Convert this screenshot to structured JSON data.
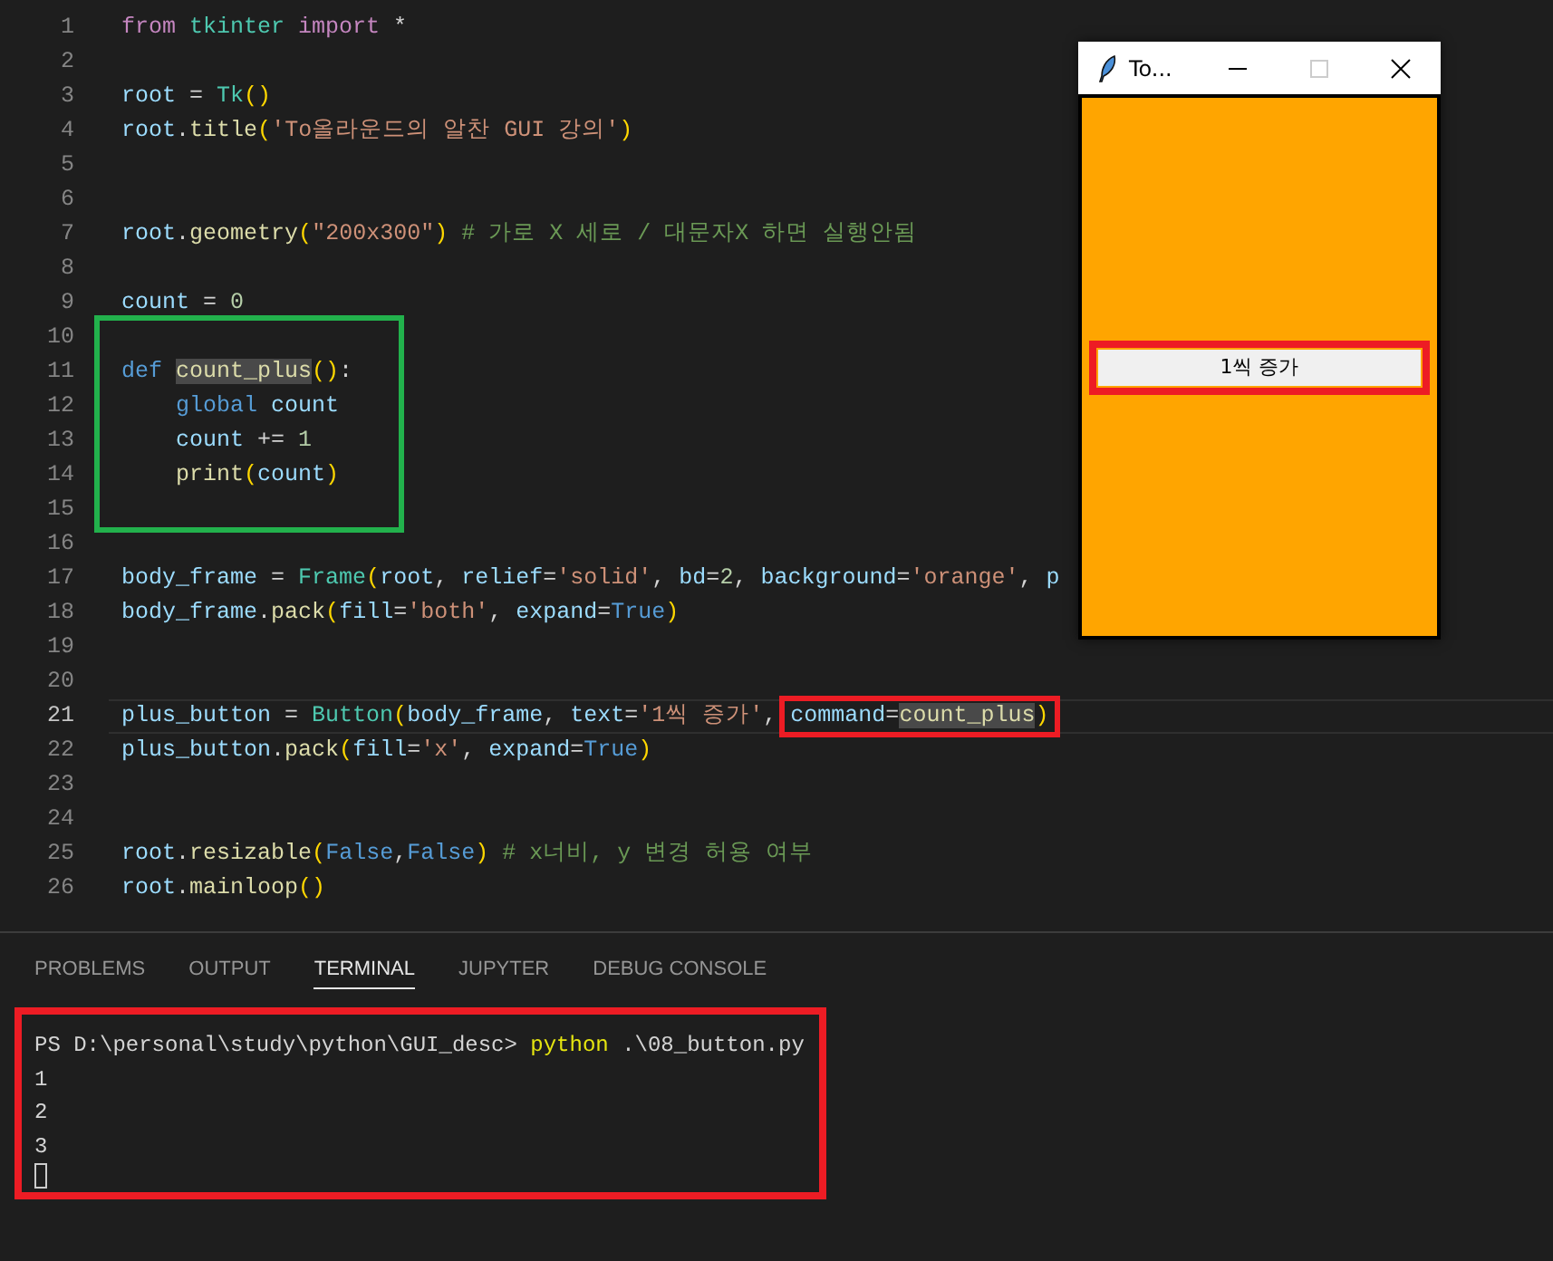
{
  "editor": {
    "lines": [
      {
        "number": "1",
        "current": false,
        "framed": false,
        "tokens": [
          {
            "text": "from",
            "kind": "kw"
          },
          {
            "text": " tkinter",
            "kind": "cls"
          },
          {
            "text": " import",
            "kind": "kw"
          },
          {
            "text": " *",
            "kind": "plain"
          }
        ]
      },
      {
        "number": "2",
        "current": false,
        "framed": false
      },
      {
        "number": "3",
        "current": false,
        "framed": false,
        "tokens": [
          {
            "text": "root",
            "kind": "var"
          },
          {
            "text": " = ",
            "kind": "plain"
          },
          {
            "text": "Tk",
            "kind": "cls"
          },
          {
            "text": "()",
            "kind": "paren"
          }
        ]
      },
      {
        "number": "4",
        "current": false,
        "framed": false,
        "tokens": [
          {
            "text": "root",
            "kind": "var"
          },
          {
            "text": ".",
            "kind": "plain"
          },
          {
            "text": "title",
            "kind": "fn"
          },
          {
            "text": "(",
            "kind": "paren"
          },
          {
            "text": "'To올라운드의 알찬 GUI 강의'",
            "kind": "str"
          },
          {
            "text": ")",
            "kind": "paren"
          }
        ]
      },
      {
        "number": "5",
        "current": false,
        "framed": false
      },
      {
        "number": "6",
        "current": false,
        "framed": false
      },
      {
        "number": "7",
        "current": false,
        "framed": false,
        "tokens": [
          {
            "text": "root",
            "kind": "var"
          },
          {
            "text": ".",
            "kind": "plain"
          },
          {
            "text": "geometry",
            "kind": "fn"
          },
          {
            "text": "(",
            "kind": "paren"
          },
          {
            "text": "\"200x300\"",
            "kind": "str"
          },
          {
            "text": ")",
            "kind": "paren"
          },
          {
            "text": " # 가로 X 세로 / 대문자X 하면 실행안됨",
            "kind": "cmt"
          }
        ]
      },
      {
        "number": "8",
        "current": false,
        "framed": false
      },
      {
        "number": "9",
        "current": false,
        "framed": false,
        "tokens": [
          {
            "text": "count",
            "kind": "var"
          },
          {
            "text": " = ",
            "kind": "plain"
          },
          {
            "text": "0",
            "kind": "num"
          }
        ]
      },
      {
        "number": "10",
        "current": false,
        "framed": true
      },
      {
        "number": "11",
        "current": false,
        "framed": true,
        "tokens": [
          {
            "text": "def ",
            "kind": "def"
          },
          {
            "text": "count_plus",
            "kind": "hl"
          },
          {
            "text": "()",
            "kind": "paren"
          },
          {
            "text": ":",
            "kind": "plain"
          }
        ]
      },
      {
        "number": "12",
        "current": false,
        "framed": true,
        "tokens": [
          {
            "text": "    global",
            "kind": "def"
          },
          {
            "text": " count",
            "kind": "var"
          }
        ]
      },
      {
        "number": "13",
        "current": false,
        "framed": true,
        "tokens": [
          {
            "text": "    count",
            "kind": "var"
          },
          {
            "text": " += ",
            "kind": "plain"
          },
          {
            "text": "1",
            "kind": "num"
          }
        ]
      },
      {
        "number": "14",
        "current": false,
        "framed": true,
        "tokens": [
          {
            "text": "    print",
            "kind": "fn"
          },
          {
            "text": "(",
            "kind": "paren"
          },
          {
            "text": "count",
            "kind": "var"
          },
          {
            "text": ")",
            "kind": "paren"
          }
        ]
      },
      {
        "number": "15",
        "current": false,
        "framed": true
      },
      {
        "number": "16",
        "current": false,
        "framed": false
      },
      {
        "number": "17",
        "current": false,
        "framed": false,
        "tokens": [
          {
            "text": "body_frame",
            "kind": "var"
          },
          {
            "text": " = ",
            "kind": "plain"
          },
          {
            "text": "Frame",
            "kind": "cls"
          },
          {
            "text": "(",
            "kind": "paren"
          },
          {
            "text": "root",
            "kind": "var"
          },
          {
            "text": ", ",
            "kind": "plain"
          },
          {
            "text": "relief",
            "kind": "var"
          },
          {
            "text": "=",
            "kind": "plain"
          },
          {
            "text": "'solid'",
            "kind": "str"
          },
          {
            "text": ", ",
            "kind": "plain"
          },
          {
            "text": "bd",
            "kind": "var"
          },
          {
            "text": "=",
            "kind": "plain"
          },
          {
            "text": "2",
            "kind": "num"
          },
          {
            "text": ", ",
            "kind": "plain"
          },
          {
            "text": "background",
            "kind": "var"
          },
          {
            "text": "=",
            "kind": "plain"
          },
          {
            "text": "'orange'",
            "kind": "str"
          },
          {
            "text": ", ",
            "kind": "plain"
          },
          {
            "text": "p",
            "kind": "var"
          }
        ]
      },
      {
        "number": "18",
        "current": false,
        "framed": false,
        "tokens": [
          {
            "text": "body_frame",
            "kind": "var"
          },
          {
            "text": ".",
            "kind": "plain"
          },
          {
            "text": "pack",
            "kind": "fn"
          },
          {
            "text": "(",
            "kind": "paren"
          },
          {
            "text": "fill",
            "kind": "var"
          },
          {
            "text": "=",
            "kind": "plain"
          },
          {
            "text": "'both'",
            "kind": "str"
          },
          {
            "text": ", ",
            "kind": "plain"
          },
          {
            "text": "expand",
            "kind": "var"
          },
          {
            "text": "=",
            "kind": "plain"
          },
          {
            "text": "True",
            "kind": "def"
          },
          {
            "text": ")",
            "kind": "paren"
          }
        ]
      },
      {
        "number": "19",
        "current": false,
        "framed": false
      },
      {
        "number": "20",
        "current": false,
        "framed": false
      },
      {
        "number": "21",
        "current": true,
        "framed": false,
        "tokens": [
          {
            "text": "plus_button",
            "kind": "var"
          },
          {
            "text": " = ",
            "kind": "plain"
          },
          {
            "text": "Button",
            "kind": "cls"
          },
          {
            "text": "(",
            "kind": "paren"
          },
          {
            "text": "body_frame",
            "kind": "var"
          },
          {
            "text": ", ",
            "kind": "plain"
          },
          {
            "text": "text",
            "kind": "var"
          },
          {
            "text": "=",
            "kind": "plain"
          },
          {
            "text": "'1씩 증가'",
            "kind": "str"
          },
          {
            "text": ", ",
            "kind": "plain"
          },
          {
            "text": "command",
            "kind": "var",
            "framed": true
          },
          {
            "text": "=",
            "kind": "plain",
            "framed": true
          },
          {
            "text": "count_plus",
            "kind": "hl",
            "framed": true
          },
          {
            "text": ")",
            "kind": "paren",
            "framed": true
          }
        ]
      },
      {
        "number": "22",
        "current": false,
        "framed": false,
        "tokens": [
          {
            "text": "plus_button",
            "kind": "var"
          },
          {
            "text": ".",
            "kind": "plain"
          },
          {
            "text": "pack",
            "kind": "fn"
          },
          {
            "text": "(",
            "kind": "paren"
          },
          {
            "text": "fill",
            "kind": "var"
          },
          {
            "text": "=",
            "kind": "plain"
          },
          {
            "text": "'x'",
            "kind": "str"
          },
          {
            "text": ", ",
            "kind": "plain"
          },
          {
            "text": "expand",
            "kind": "var"
          },
          {
            "text": "=",
            "kind": "plain"
          },
          {
            "text": "True",
            "kind": "def"
          },
          {
            "text": ")",
            "kind": "paren"
          }
        ]
      },
      {
        "number": "23",
        "current": false,
        "framed": false
      },
      {
        "number": "24",
        "current": false,
        "framed": false
      },
      {
        "number": "25",
        "current": false,
        "framed": false,
        "tokens": [
          {
            "text": "root",
            "kind": "var"
          },
          {
            "text": ".",
            "kind": "plain"
          },
          {
            "text": "resizable",
            "kind": "fn"
          },
          {
            "text": "(",
            "kind": "paren"
          },
          {
            "text": "False",
            "kind": "def"
          },
          {
            "text": ",",
            "kind": "plain"
          },
          {
            "text": "False",
            "kind": "def"
          },
          {
            "text": ")",
            "kind": "paren"
          },
          {
            "text": " # x너비, y 변경 허용 여부",
            "kind": "cmt"
          }
        ]
      },
      {
        "number": "26",
        "current": false,
        "framed": false,
        "tokens": [
          {
            "text": "root",
            "kind": "var"
          },
          {
            "text": ".",
            "kind": "plain"
          },
          {
            "text": "mainloop",
            "kind": "fn"
          },
          {
            "text": "()",
            "kind": "paren"
          }
        ]
      }
    ]
  },
  "tk_window": {
    "title": "To...",
    "maximize_disabled": true,
    "button": {
      "label": "1씩 증가",
      "framed": true
    }
  },
  "panel": {
    "tabs": [
      {
        "label": "PROBLEMS",
        "selected": false
      },
      {
        "label": "OUTPUT",
        "selected": false
      },
      {
        "label": "TERMINAL",
        "selected": true
      },
      {
        "label": "JUPYTER",
        "selected": false
      },
      {
        "label": "DEBUG CONSOLE",
        "selected": false
      }
    ],
    "terminal": {
      "framed": true,
      "lines": [
        [
          {
            "text": "PS D:\\personal\\study\\python\\GUI_desc> ",
            "kind": "plain"
          },
          {
            "text": "python",
            "kind": "cmd"
          },
          {
            "text": " .\\08_button.py",
            "kind": "plain"
          }
        ],
        [
          {
            "text": "1",
            "kind": "plain"
          }
        ],
        [
          {
            "text": "2",
            "kind": "plain"
          }
        ],
        [
          {
            "text": "3",
            "kind": "plain"
          }
        ]
      ],
      "cursor": true
    }
  }
}
